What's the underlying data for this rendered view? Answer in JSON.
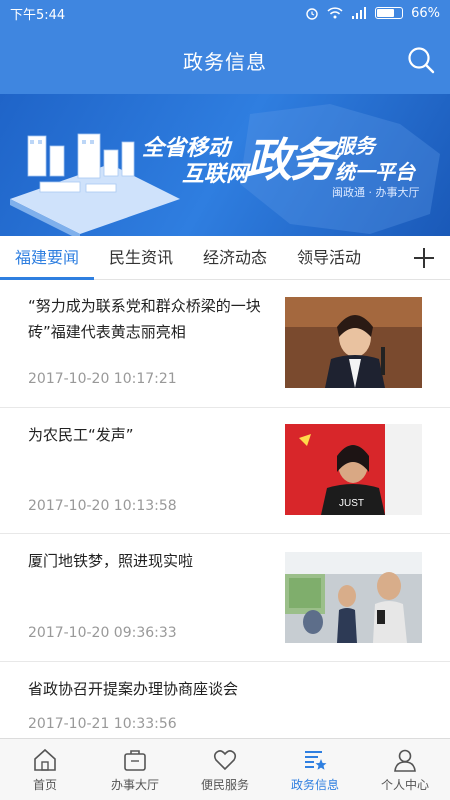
{
  "status": {
    "time": "下午5:44",
    "battery": "66%"
  },
  "header": {
    "title": "政务信息"
  },
  "banner": {
    "line1": "全省移动",
    "line2": "互联网",
    "big": "政务",
    "service": "服务",
    "platform": "统一平台",
    "sub": "闽政通 · 办事大厅"
  },
  "tabs": [
    {
      "label": "福建要闻",
      "active": true
    },
    {
      "label": "民生资讯",
      "active": false
    },
    {
      "label": "经济动态",
      "active": false
    },
    {
      "label": "领导活动",
      "active": false
    }
  ],
  "news": [
    {
      "headline": "“努力成为联系党和群众桥梁的一块砖”福建代表黄志丽亮相",
      "date": "2017-10-20 10:17:21"
    },
    {
      "headline": "为农民工“发声”",
      "date": "2017-10-20 10:13:58"
    },
    {
      "headline": "厦门地铁梦，照进现实啦",
      "date": "2017-10-20 09:36:33"
    },
    {
      "headline": "省政协召开提案办理协商座谈会",
      "date": "2017-10-21 10:33:56"
    }
  ],
  "nav": [
    {
      "label": "首页",
      "icon": "home-icon"
    },
    {
      "label": "办事大厅",
      "icon": "briefcase-icon"
    },
    {
      "label": "便民服务",
      "icon": "heart-icon"
    },
    {
      "label": "政务信息",
      "icon": "news-star-icon",
      "active": true
    },
    {
      "label": "个人中心",
      "icon": "person-icon"
    }
  ],
  "colors": {
    "primary": "#3f86e0",
    "accent": "#2f7fe0"
  }
}
